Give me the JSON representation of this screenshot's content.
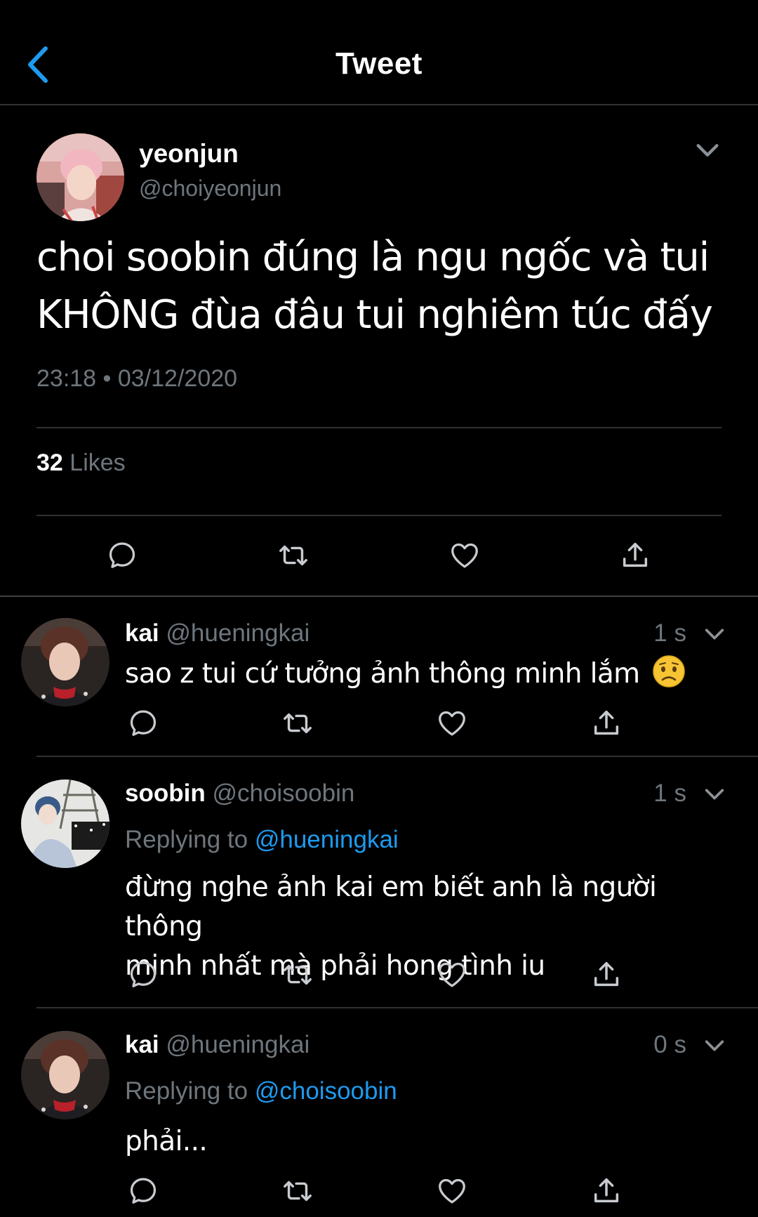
{
  "header": {
    "title": "Tweet",
    "back_icon": "chevron-left-icon",
    "accent_color": "#1d9bf0"
  },
  "main_tweet": {
    "name": "yeonjun",
    "handle": "@choiyeonjun",
    "text_line1": "choi soobin đúng là ngu ngốc và tui",
    "text_line2": "KHÔNG đùa đâu tui nghiêm túc đấy",
    "timestamp": "23:18 • 03/12/2020",
    "likes_count": "32",
    "likes_label": "Likes",
    "actions": [
      "reply-icon",
      "retweet-icon",
      "like-icon",
      "share-icon"
    ]
  },
  "replies": [
    {
      "name": "kai",
      "handle": "@hueningkai",
      "time": "1 s",
      "replying_label": "",
      "replying_to": "",
      "text_line1": "sao z tui cứ tưởng ảnh thông minh lắm",
      "text_line2": "",
      "emoji": "worried-face-emoji"
    },
    {
      "name": "soobin",
      "handle": "@choisoobin",
      "time": "1 s",
      "replying_label": "Replying to",
      "replying_to": "@hueningkai",
      "text_line1": "đừng nghe ảnh kai em biết anh là người thông",
      "text_line2": "minh nhất mà phải hong tình iu"
    },
    {
      "name": "kai",
      "handle": "@hueningkai",
      "time": "0 s",
      "replying_label": "Replying to",
      "replying_to": "@choisoobin",
      "text_line1": "phải...",
      "text_line2": ""
    }
  ],
  "colors": {
    "background": "#000000",
    "secondary_text": "#6e767d",
    "divider": "#2f3336",
    "link": "#1d9bf0"
  }
}
